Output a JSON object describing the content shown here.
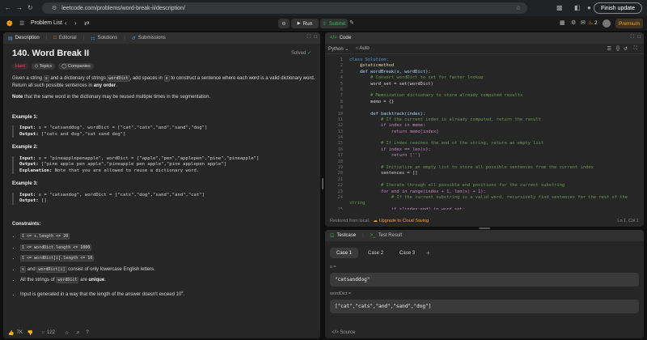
{
  "browser": {
    "url": "leetcode.com/problems/word-break-ii/description/",
    "update_label": "Finish update"
  },
  "nav": {
    "problem_list": "Problem List",
    "run": "Run",
    "submit": "Submit",
    "streak": "2",
    "premium": "Premium"
  },
  "left_tabs": [
    {
      "label": "Description"
    },
    {
      "label": "Editorial"
    },
    {
      "label": "Solutions"
    },
    {
      "label": "Submissions"
    }
  ],
  "problem": {
    "title": "140. Word Break II",
    "status": "Solved",
    "difficulty": "Hard",
    "topics": "Topics",
    "companies": "Companies",
    "p1a": "Given a string ",
    "p1s": "s",
    "p1b": " and a dictionary of strings ",
    "p1w": "wordDict",
    "p1c": ", add spaces in ",
    "p1s2": "s",
    "p1d": " to construct a sentence where each word is a valid dictionary word. Return all such possible sentences in ",
    "p1e": "any order",
    ".": ".",
    "p1end": ".",
    "p2a": "Note",
    "p2b": " that the same word in the dictionary may be reused multiple times in the segmentation.",
    "examples": [
      {
        "title": "Example 1:",
        "input": "s = \"catsanddog\", wordDict = [\"cat\",\"cats\",\"and\",\"sand\",\"dog\"]",
        "output": "[\"cats and dog\",\"cat sand dog\"]",
        "explanation": ""
      },
      {
        "title": "Example 2:",
        "input": "s = \"pineapplepenapple\", wordDict = [\"apple\",\"pen\",\"applepen\",\"pine\",\"pineapple\"]",
        "output": "[\"pine apple pen apple\",\"pineapple pen apple\",\"pine applepen apple\"]",
        "explanation": "Note that you are allowed to reuse a dictionary word."
      },
      {
        "title": "Example 3:",
        "input": "s = \"catsandog\", wordDict = [\"cats\",\"dog\",\"sand\",\"and\",\"cat\"]",
        "output": "[]",
        "explanation": ""
      }
    ],
    "input_label": "Input:",
    "output_label": "Output:",
    "explanation_label": "Explanation:",
    "constraints_title": "Constraints:",
    "c1": "1 <= s.length <= 20",
    "c2": "1 <= wordDict.length <= 1000",
    "c3": "1 <= wordDict[i].length <= 10",
    "c4a": "s",
    "c4b": " and ",
    "c4c": "wordDict[i]",
    "c4d": " consist of only lowercase English letters.",
    "c5a": "All the strings of ",
    "c5b": "wordDict",
    "c5c": " are ",
    "c5d": "unique",
    "c6": "Input is generated in a way that the length of the answer doesn't exceed 10",
    "c6sup": "5",
    "likes": "7K",
    "comments": "122"
  },
  "code_panel": {
    "tab": "Code",
    "language": "Python",
    "auto": "Auto",
    "footer_left": "Restored from local.",
    "upgrade": "Upgrade to Cloud Saving",
    "cursor": "Ln 1, Col 1"
  },
  "code_lines": [
    {
      "n": "1",
      "t": "class Solution:",
      "c": "#569cd6"
    },
    {
      "n": "2",
      "t": "    @staticmethod",
      "c": "#dcdcaa"
    },
    {
      "n": "3",
      "t": "    def wordBreak(s, wordDict):",
      "c": "#9cdcfe"
    },
    {
      "n": "4",
      "t": "        # Convert wordDict to set for faster lookup",
      "c": "#6a9955"
    },
    {
      "n": "5",
      "t": "        word_set = set(wordDict)",
      "c": "#d4d4d4"
    },
    {
      "n": "6",
      "t": "",
      "c": "#d4d4d4"
    },
    {
      "n": "7",
      "t": "        # Memoization dictionary to store already computed results",
      "c": "#6a9955"
    },
    {
      "n": "8",
      "t": "        memo = {}",
      "c": "#d4d4d4"
    },
    {
      "n": "9",
      "t": "",
      "c": "#d4d4d4"
    },
    {
      "n": "10",
      "t": "        def backtrack(index):",
      "c": "#9cdcfe"
    },
    {
      "n": "11",
      "t": "            # If the current index is already computed, return the result",
      "c": "#6a9955"
    },
    {
      "n": "12",
      "t": "            if index in memo:",
      "c": "#c586c0"
    },
    {
      "n": "13",
      "t": "                return memo[index]",
      "c": "#c586c0"
    },
    {
      "n": "14",
      "t": "",
      "c": "#d4d4d4"
    },
    {
      "n": "15",
      "t": "            # If index reaches the end of the string, return an empty list",
      "c": "#6a9955"
    },
    {
      "n": "16",
      "t": "            if index == len(s):",
      "c": "#c586c0"
    },
    {
      "n": "17",
      "t": "                return ['']",
      "c": "#c586c0"
    },
    {
      "n": "18",
      "t": "",
      "c": "#d4d4d4"
    },
    {
      "n": "19",
      "t": "            # Initialize an empty list to store all possible sentences from the current index",
      "c": "#6a9955"
    },
    {
      "n": "20",
      "t": "            sentences = []",
      "c": "#d4d4d4"
    },
    {
      "n": "21",
      "t": "",
      "c": "#d4d4d4"
    },
    {
      "n": "22",
      "t": "            # Iterate through all possible end positions for the current substring",
      "c": "#6a9955"
    },
    {
      "n": "23",
      "t": "            for end in range(index + 1, len(s) + 1):",
      "c": "#c586c0"
    },
    {
      "n": "24",
      "t": "                # If the current substring is a valid word, recursively find sentences for the rest of the",
      "c": "#6a9955"
    },
    {
      "n": "",
      "t": "string",
      "c": "#6a9955"
    },
    {
      "n": "25",
      "t": "                if s[index:end] in word_set:",
      "c": "#c586c0"
    }
  ],
  "testcase": {
    "tab1": "Testcase",
    "tab2": "Test Result",
    "cases": [
      "Case 1",
      "Case 2",
      "Case 3"
    ],
    "add": "+",
    "var1": "s =",
    "val1": "\"catsanddog\"",
    "var2": "wordDict =",
    "val2": "[\"cat\",\"cats\",\"and\",\"sand\",\"dog\"]",
    "source": "Source"
  },
  "colors": {
    "accent": "#ffa116",
    "hard": "#ff375f",
    "solved": "#2cbb5d",
    "link": "#4a9dff"
  }
}
